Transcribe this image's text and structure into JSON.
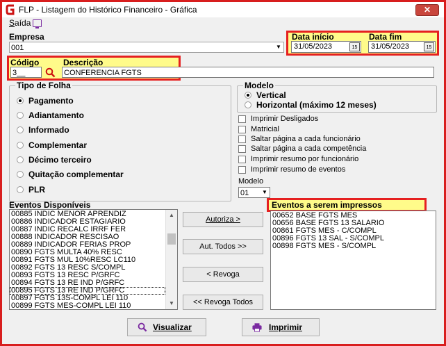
{
  "window": {
    "title": "FLP - Listagem do Histórico Financeiro - Gráfica",
    "close_glyph": "✕"
  },
  "menu": {
    "saida": "Saída",
    "saida_accel": "S",
    "saida_rest": "aída"
  },
  "empresa": {
    "label": "Empresa",
    "value": "001"
  },
  "data_inicio": {
    "label": "Data início",
    "value": "31/05/2023"
  },
  "data_fim": {
    "label": "Data fim",
    "value": "31/05/2023"
  },
  "codigo": {
    "label": "Código",
    "value": "3__"
  },
  "descricao": {
    "label": "Descrição",
    "value": "CONFERENCIA FGTS"
  },
  "tipo_folha": {
    "title": "Tipo de Folha",
    "options": [
      "Pagamento",
      "Adiantamento",
      "Informado",
      "Complementar",
      "Décimo terceiro",
      "Quitação complementar",
      "PLR"
    ],
    "selected": "Pagamento"
  },
  "modelo_group": {
    "title": "Modelo",
    "options": [
      "Vertical",
      "Horizontal (máximo 12 meses)"
    ],
    "selected": "Vertical"
  },
  "checkboxes": [
    "Imprimir Desligados",
    "Matricial",
    "Saltar página a cada funcionário",
    "Saltar página a cada competência",
    "Imprimir resumo por funcionário",
    "Imprimir resumo de eventos"
  ],
  "modelo_select": {
    "label": "Modelo",
    "value": "01"
  },
  "eventos_disponiveis": {
    "title": "Eventos Disponíveis",
    "items": [
      "00885 INDIC MENOR APRENDIZ",
      "00886 INDICADOR ESTAGIARIO",
      "00887 INDIC RECALC IRRF FER",
      "00888 INDICADOR RESCISAO",
      "00889 INDICADOR FERIAS PROP",
      "00890 FGTS MULTA 40% RESC",
      "00891 FGTS MUL 10%RESC LC110",
      "00892 FGTS 13 RESC S/COMPL",
      "00893 FGTS 13 RESC P/GRFC",
      "00894 FGTS 13 RE IND P/GRFC",
      "00895 FGTS 13 RE IND P/GRFC",
      "00897 FGTS 13S-COMPL LEI 110",
      "00899 FGTS MES-COMPL LEI 110"
    ]
  },
  "eventos_impressos": {
    "title": "Eventos a serem impressos",
    "items": [
      "00652 BASE FGTS MES",
      "00656 BASE FGTS 13 SALARIO",
      "00861 FGTS MES - C/COMPL",
      "00896 FGTS 13 SAL - S/COMPL",
      "00898 FGTS MES - S/COMPL"
    ]
  },
  "buttons": {
    "autoriza": "Autoriza >",
    "aut_todos": "Aut. Todos >>",
    "revoga": "< Revoga",
    "revoga_todos": "<< Revoga Todos",
    "visualizar": "Visualizar",
    "imprimir": "Imprimir"
  },
  "colors": {
    "highlight_border": "#e52020",
    "highlight_fill": "#fffb8a",
    "window_border": "#d81e1e",
    "icon_red": "#cc1111",
    "icon_purple": "#7a2aa0"
  }
}
